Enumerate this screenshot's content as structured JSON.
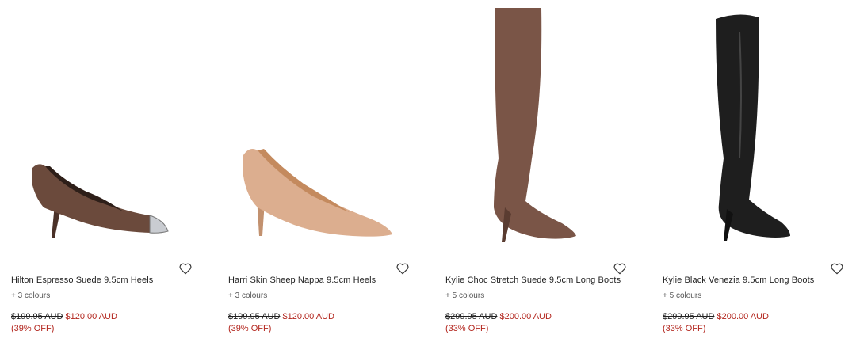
{
  "products": [
    {
      "name": "Hilton Espresso Suede 9.5cm Heels",
      "colours": "+ 3 colours",
      "was_price": "$199.95 AUD",
      "now_price": "$120.00 AUD",
      "discount": "(39% OFF)",
      "image_icon": "brown-suede-pump-image",
      "color": "#6b4a3c"
    },
    {
      "name": "Harri Skin Sheep Nappa 9.5cm Heels",
      "colours": "+ 3 colours",
      "was_price": "$199.95 AUD",
      "now_price": "$120.00 AUD",
      "discount": "(39% OFF)",
      "image_icon": "nude-leather-pump-image",
      "color": "#d9ab8d"
    },
    {
      "name": "Kylie Choc Stretch Suede 9.5cm Long Boots",
      "colours": "+ 5 colours",
      "was_price": "$299.95 AUD",
      "now_price": "$200.00 AUD",
      "discount": "(33% OFF)",
      "image_icon": "brown-over-knee-boot-image",
      "color": "#7a5547"
    },
    {
      "name": "Kylie Black Venezia 9.5cm Long Boots",
      "colours": "+ 5 colours",
      "was_price": "$299.95 AUD",
      "now_price": "$200.00 AUD",
      "discount": "(33% OFF)",
      "image_icon": "black-over-knee-boot-image",
      "color": "#1e1e1e"
    }
  ],
  "wishlist_icon": "heart-outline-icon",
  "accent_sale_color": "#b3261e"
}
